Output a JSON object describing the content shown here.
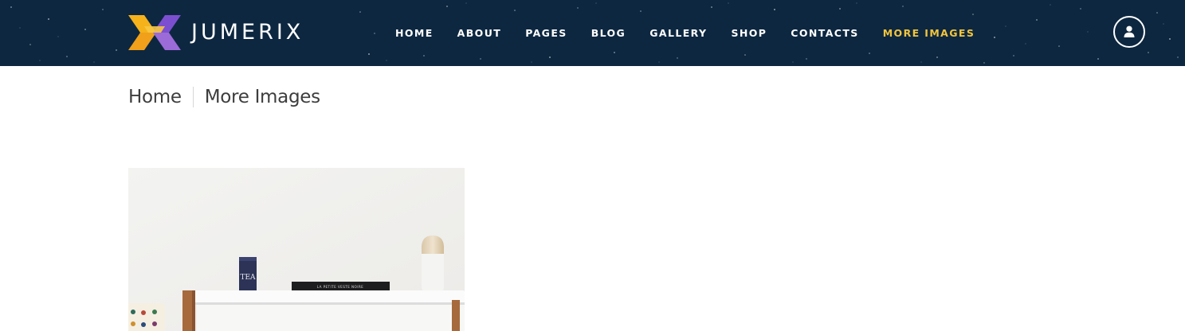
{
  "site": {
    "logo_text": "JUMERIX"
  },
  "nav": {
    "items": [
      {
        "label": "HOME"
      },
      {
        "label": "ABOUT"
      },
      {
        "label": "PAGES"
      },
      {
        "label": "BLOG"
      },
      {
        "label": "GALLERY"
      },
      {
        "label": "SHOP"
      },
      {
        "label": "CONTACTS"
      },
      {
        "label": "MORE IMAGES",
        "active": true
      }
    ],
    "active_color": "#f2c53d"
  },
  "user": {
    "icon": "user-icon"
  },
  "breadcrumb": {
    "home": "Home",
    "current": "More Images"
  },
  "photo": {
    "tea_box_text": "TEA",
    "book_spine_text": "LA PETITE VESTE NOIRE"
  },
  "colors": {
    "header_bg": "#0d2740",
    "logo_yellow": "#f5b21b",
    "logo_purple": "#9b6bd8",
    "text_dark": "#3d3d3d"
  }
}
